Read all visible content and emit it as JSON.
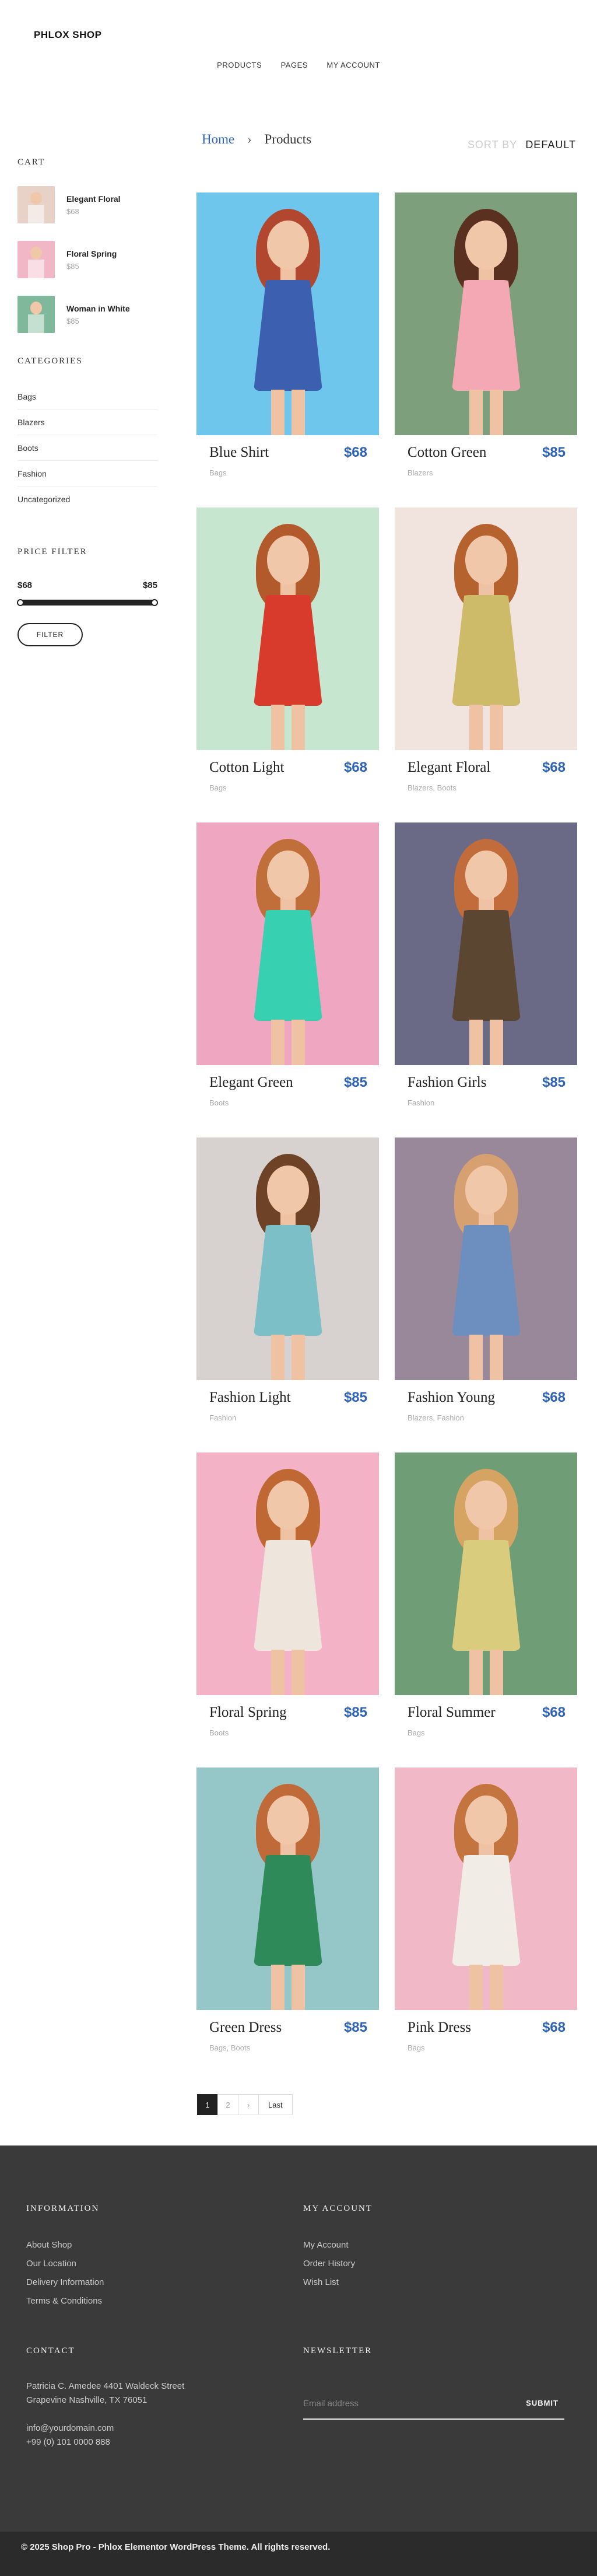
{
  "header": {
    "logo": "PHLOX SHOP",
    "nav": [
      "PRODUCTS",
      "PAGES",
      "MY ACCOUNT"
    ]
  },
  "breadcrumb": {
    "home": "Home",
    "separator": "›",
    "current": "Products"
  },
  "sort": {
    "label": "SORT BY",
    "value": "DEFAULT"
  },
  "sidebar": {
    "cart_title": "CART",
    "cart": [
      {
        "name": "Elegant Floral",
        "price": "$68",
        "bg": "#e8d2c8"
      },
      {
        "name": "Floral Spring",
        "price": "$85",
        "bg": "#f2b7c7"
      },
      {
        "name": "Woman in White",
        "price": "$85",
        "bg": "#7fb89a"
      }
    ],
    "categories_title": "CATEGORIES",
    "categories": [
      "Bags",
      "Blazers",
      "Boots",
      "Fashion",
      "Uncategorized"
    ],
    "price_filter_title": "PRICE FILTER",
    "price_min": "$68",
    "price_max": "$85",
    "filter_button": "FILTER"
  },
  "products": [
    {
      "name": "Blue Shirt",
      "price": "$68",
      "cats": "Bags",
      "bg": "#6ec6ec",
      "dress": "#3d5fb0",
      "hair": "#b0472e"
    },
    {
      "name": "Cotton Green",
      "price": "$85",
      "cats": "Blazers",
      "bg": "#7e9f7c",
      "dress": "#f3a8b4",
      "hair": "#5a3020"
    },
    {
      "name": "Cotton Light",
      "price": "$68",
      "cats": "Bags",
      "bg": "#c6e6cf",
      "dress": "#d83b2c",
      "hair": "#b25a2c"
    },
    {
      "name": "Elegant Floral",
      "price": "$68",
      "cats": "Blazers, Boots",
      "bg": "#f1e4df",
      "dress": "#cdbb6a",
      "hair": "#b5622e"
    },
    {
      "name": "Elegant Green",
      "price": "$85",
      "cats": "Boots",
      "bg": "#efa6c0",
      "dress": "#37d0b0",
      "hair": "#c06e3a"
    },
    {
      "name": "Fashion Girls",
      "price": "$85",
      "cats": "Fashion",
      "bg": "#6b6a86",
      "dress": "#5b4632",
      "hair": "#c26b3b"
    },
    {
      "name": "Fashion Light",
      "price": "$85",
      "cats": "Fashion",
      "bg": "#d7d2cf",
      "dress": "#7cbfc7",
      "hair": "#6e4226"
    },
    {
      "name": "Fashion Young",
      "price": "$68",
      "cats": "Blazers, Fashion",
      "bg": "#98889a",
      "dress": "#6c8fc0",
      "hair": "#d6a070"
    },
    {
      "name": "Floral Spring",
      "price": "$85",
      "cats": "Boots",
      "bg": "#f3b2c6",
      "dress": "#eee6dc",
      "hair": "#c06833"
    },
    {
      "name": "Floral Summer",
      "price": "$68",
      "cats": "Bags",
      "bg": "#6f9d76",
      "dress": "#d9cc7c",
      "hair": "#d6a462"
    },
    {
      "name": "Green Dress",
      "price": "$85",
      "cats": "Bags, Boots",
      "bg": "#96c7c8",
      "dress": "#2f8a5a",
      "hair": "#c06a3a"
    },
    {
      "name": "Pink Dress",
      "price": "$68",
      "cats": "Bags",
      "bg": "#f1b8c8",
      "dress": "#f2ece6",
      "hair": "#c4743e"
    }
  ],
  "pagination": {
    "pages": [
      "1",
      "2",
      "›"
    ],
    "last": "Last"
  },
  "footer": {
    "information_title": "INFORMATION",
    "information_links": [
      "About Shop",
      "Our Location",
      "Delivery Information",
      "Terms & Conditions"
    ],
    "account_title": "MY ACCOUNT",
    "account_links": [
      "My Account",
      "Order History",
      "Wish List"
    ],
    "contact_title": "CONTACT",
    "contact_address_1": "Patricia C. Amedee 4401 Waldeck Street",
    "contact_address_2": "Grapevine Nashville, TX 76051",
    "contact_email": "info@yourdomain.com",
    "contact_phone": "+99 (0) 101 0000 888",
    "newsletter_title": "NEWSLETTER",
    "newsletter_placeholder": "Email address",
    "newsletter_submit": "SUBMIT",
    "copyright": "© 2025 Shop Pro - Phlox Elementor WordPress Theme. All rights reserved."
  }
}
